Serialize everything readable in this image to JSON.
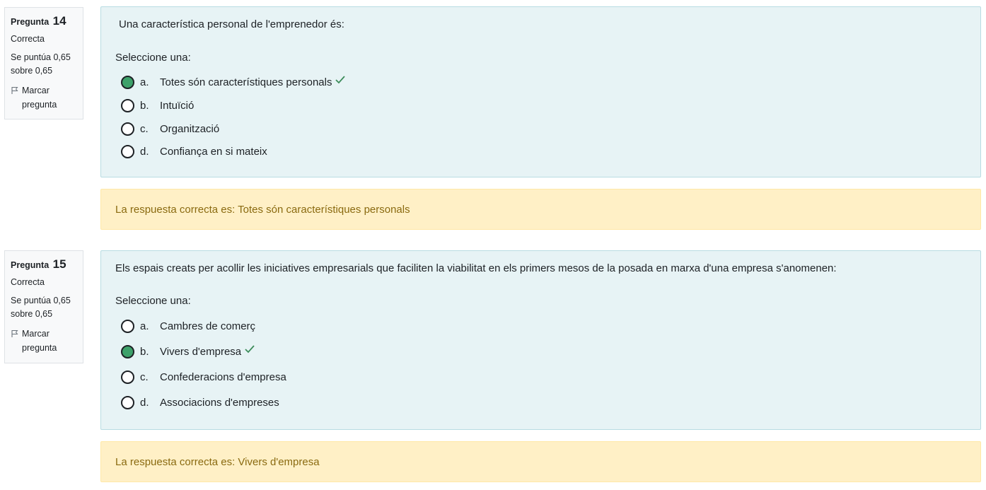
{
  "questions": [
    {
      "label": "Pregunta",
      "number": "14",
      "state": "Correcta",
      "grade": "Se puntúa 0,65 sobre 0,65",
      "flag_label": "Marcar pregunta",
      "text": "Una característica personal de l'emprenedor és:",
      "prompt": "Seleccione una:",
      "answers": [
        {
          "letter": "a.",
          "text": "Totes són característiques personals",
          "selected": true,
          "correct": true
        },
        {
          "letter": "b.",
          "text": "Intuïció",
          "selected": false,
          "correct": false
        },
        {
          "letter": "c.",
          "text": "Organització",
          "selected": false,
          "correct": false
        },
        {
          "letter": "d.",
          "text": "Confiança en si mateix",
          "selected": false,
          "correct": false
        }
      ],
      "feedback": "La respuesta correcta es: Totes són característiques personals"
    },
    {
      "label": "Pregunta",
      "number": "15",
      "state": "Correcta",
      "grade": "Se puntúa 0,65 sobre 0,65",
      "flag_label": "Marcar pregunta",
      "text": "Els espais creats per acollir les iniciatives empresarials que faciliten la viabilitat en els primers mesos de la posada en marxa d'una empresa s'anomenen:",
      "prompt": "Seleccione una:",
      "answers": [
        {
          "letter": "a.",
          "text": "Cambres de comerç",
          "selected": false,
          "correct": false
        },
        {
          "letter": "b.",
          "text": "Vivers d'empresa",
          "selected": true,
          "correct": true
        },
        {
          "letter": "c.",
          "text": "Confederacions d'empresa",
          "selected": false,
          "correct": false
        },
        {
          "letter": "d.",
          "text": "Associacions d'empreses",
          "selected": false,
          "correct": false
        }
      ],
      "feedback": "La respuesta correcta es: Vivers d'empresa"
    }
  ],
  "colors": {
    "selected_radio": "#3da16a",
    "tick": "#3c8c5a",
    "content_bg": "#e7f3f5",
    "feedback_bg": "#fff0c6",
    "feedback_text": "#8a6a10"
  },
  "icons": {
    "flag": "flag-icon",
    "correct": "check-icon"
  }
}
